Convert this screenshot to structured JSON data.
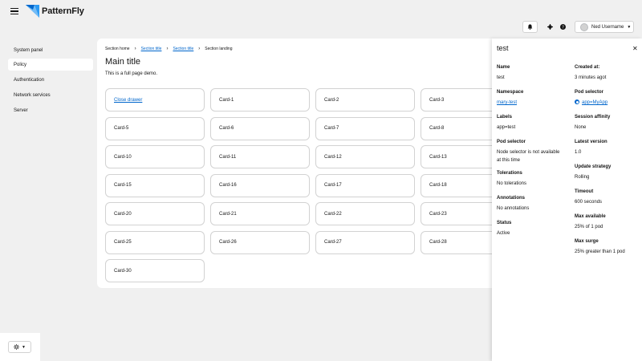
{
  "header": {
    "brand": "PatternFly",
    "user_name": "Ned Username"
  },
  "sidebar": {
    "items": [
      {
        "label": "System panel"
      },
      {
        "label": "Policy"
      },
      {
        "label": "Authentication"
      },
      {
        "label": "Network services"
      },
      {
        "label": "Server"
      }
    ]
  },
  "breadcrumb": {
    "items": [
      "Section home",
      "Section title",
      "Section title",
      "Section landing"
    ]
  },
  "main": {
    "title": "Main title",
    "description": "This is a full page demo.",
    "close_drawer_label": "Close drawer",
    "cards": [
      "Card-1",
      "Card-2",
      "Card-3",
      "Card-5",
      "Card-6",
      "Card-7",
      "Card-8",
      "Card-10",
      "Card-11",
      "Card-12",
      "Card-13",
      "Card-15",
      "Card-16",
      "Card-17",
      "Card-18",
      "Card-20",
      "Card-21",
      "Card-22",
      "Card-23",
      "Card-25",
      "Card-26",
      "Card-27",
      "Card-28",
      "Card-30"
    ]
  },
  "drawer": {
    "title": "test",
    "close_icon": "close-icon",
    "fields": {
      "name": {
        "label": "Name",
        "value": "test"
      },
      "namespace": {
        "label": "Namespace",
        "value": "mary-test"
      },
      "labels": {
        "label": "Labels",
        "value": "app=test"
      },
      "pod_selector_left": {
        "label": "Pod selector",
        "value": "Node selector is not available at this time"
      },
      "tolerations": {
        "label": "Tolerations",
        "value": "No tolerations"
      },
      "annotations": {
        "label": "Annotations",
        "value": "No annotations"
      },
      "status": {
        "label": "Status",
        "value": "Active"
      },
      "created_at": {
        "label": "Created at:",
        "value": "3 minutes agot"
      },
      "pod_selector_right": {
        "label": "Pod selector",
        "value": "app=MyApp"
      },
      "session_affinity": {
        "label": "Session affinity",
        "value": "None"
      },
      "latest_version": {
        "label": "Latest version",
        "value": "1.0"
      },
      "update_strategy": {
        "label": "Update strategy",
        "value": "Rolling"
      },
      "timeout": {
        "label": "Timeout",
        "value": "600 seconds"
      },
      "max_available": {
        "label": "Max available",
        "value": "25% of 1 pod"
      },
      "max_surge": {
        "label": "Max surge",
        "value": "25% greater than 1 pod"
      }
    }
  },
  "colors": {
    "link": "#0066cc",
    "background": "#f0f0f0",
    "brand_blue": "#2b9af3"
  },
  "icons": [
    "hamburger-icon",
    "patternfly-logo-icon",
    "bell-icon",
    "gear-icon",
    "help-icon",
    "caret-down-icon",
    "close-icon",
    "theme-sun-icon",
    "chevron-right-icon",
    "pod-selector-icon"
  ]
}
